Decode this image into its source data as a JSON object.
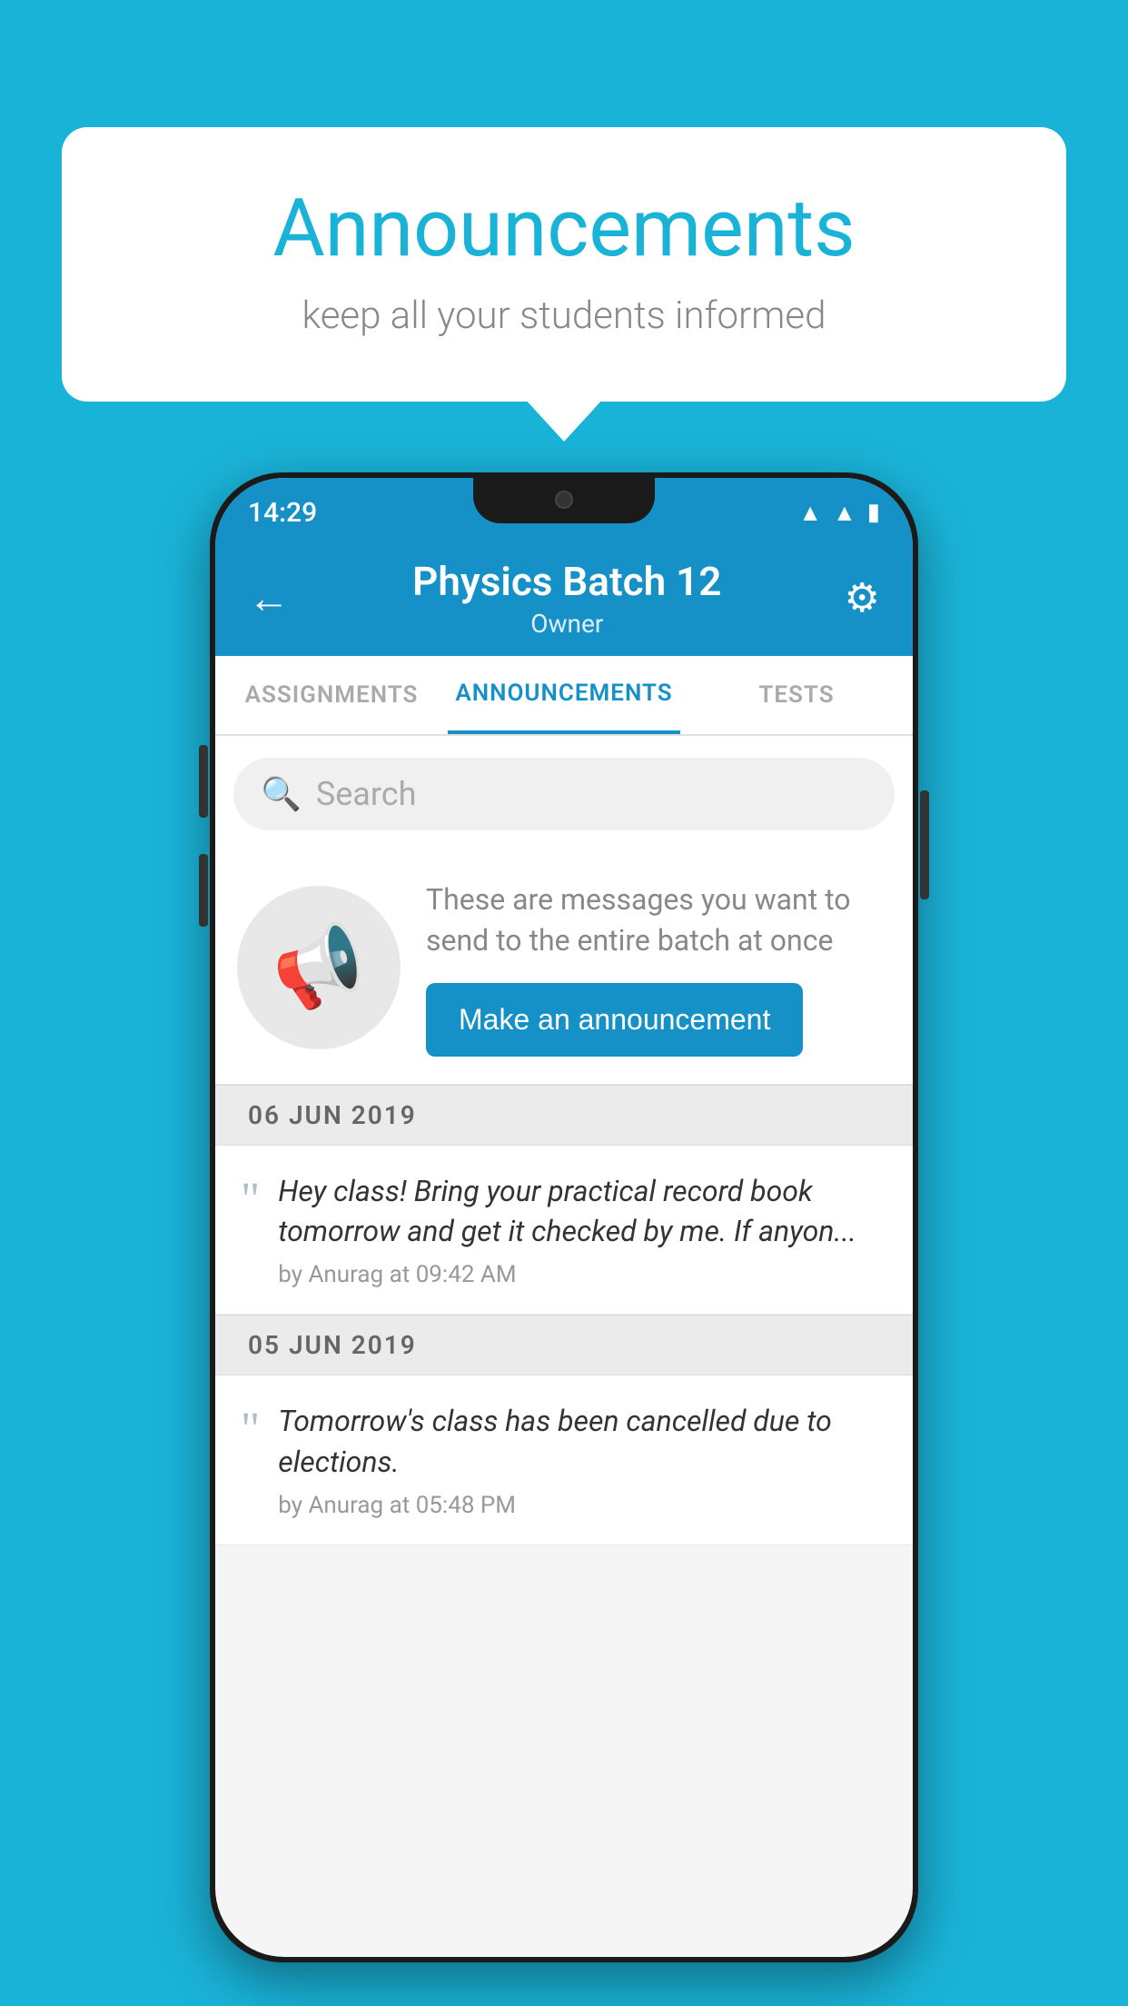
{
  "background_color": "#1ab3d8",
  "speech_bubble": {
    "title": "Announcements",
    "subtitle": "keep all your students informed"
  },
  "phone": {
    "status_bar": {
      "time": "14:29",
      "icons": [
        "wifi",
        "signal",
        "battery"
      ]
    },
    "header": {
      "title": "Physics Batch 12",
      "subtitle": "Owner",
      "back_label": "←",
      "gear_label": "⚙"
    },
    "tabs": [
      {
        "label": "ASSIGNMENTS",
        "active": false
      },
      {
        "label": "ANNOUNCEMENTS",
        "active": true
      },
      {
        "label": "TESTS",
        "active": false
      }
    ],
    "search": {
      "placeholder": "Search"
    },
    "announcement_prompt": {
      "description": "These are messages you want to send to the entire batch at once",
      "button_label": "Make an announcement"
    },
    "announcements": [
      {
        "date": "06  JUN  2019",
        "message": "Hey class! Bring your practical record book tomorrow and get it checked by me. If anyon...",
        "meta": "by Anurag at 09:42 AM"
      },
      {
        "date": "05  JUN  2019",
        "message": "Tomorrow's class has been cancelled due to elections.",
        "meta": "by Anurag at 05:48 PM"
      }
    ]
  }
}
